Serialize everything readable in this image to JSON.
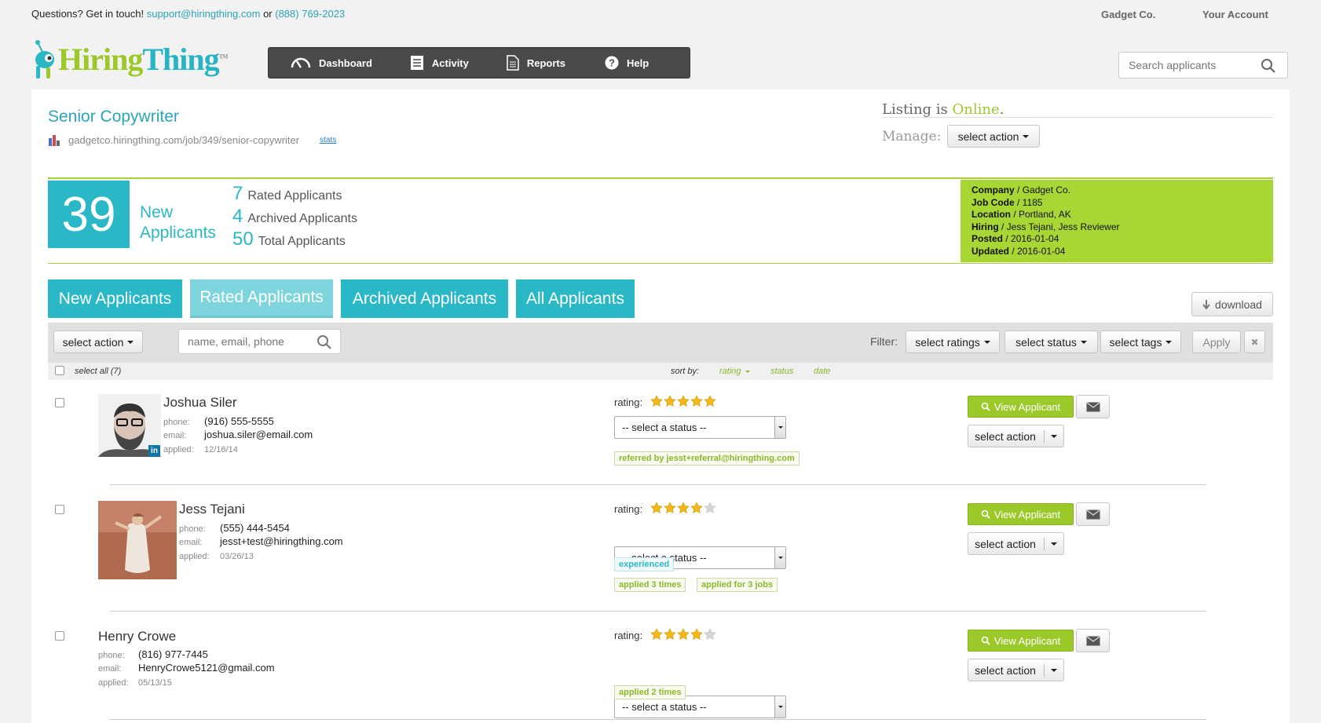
{
  "topbar": {
    "contact_prefix": "Questions? Get in touch!",
    "email": "support@hiringthing.com",
    "or": "or",
    "phone": "(888) 769-2023",
    "company": "Gadget Co.",
    "account": "Your Account"
  },
  "brand": {
    "part1": "H",
    "part2": "iring",
    "part3": "Thing",
    "tm": "TM",
    "colors": {
      "teal": "#2ab7c6",
      "green": "#9cc92a"
    }
  },
  "nav": {
    "items": [
      {
        "label": "Dashboard",
        "icon": "speedometer-icon"
      },
      {
        "label": "Activity",
        "icon": "list-icon"
      },
      {
        "label": "Reports",
        "icon": "document-icon"
      },
      {
        "label": "Help",
        "icon": "help-icon"
      }
    ]
  },
  "search": {
    "placeholder": "Search applicants"
  },
  "job": {
    "title": "Senior Copywriter",
    "url": "gadgetco.hiringthing.com/job/349/senior-copywriter",
    "stats_link": "stats",
    "listing_prefix": "Listing is",
    "listing_status": "Online",
    "listing_suffix": ".",
    "manage_label": "Manage:",
    "manage_action": "select action"
  },
  "summary": {
    "new_count": "39",
    "new_label_1": "New",
    "new_label_2": "Applicants",
    "rated_count": "7",
    "rated_label": "Rated Applicants",
    "archived_count": "4",
    "archived_label": "Archived Applicants",
    "total_count": "50",
    "total_label": "Total Applicants"
  },
  "meta": [
    {
      "key": "Company",
      "value": " / Gadget Co."
    },
    {
      "key": "Job Code",
      "value": " / 1185"
    },
    {
      "key": "Location",
      "value": " / Portland, AK"
    },
    {
      "key": "Hiring",
      "value": " / Jess Tejani, Jess Reviewer"
    },
    {
      "key": "Posted",
      "value": " / 2016-01-04"
    },
    {
      "key": "Updated",
      "value": " / 2016-01-04"
    }
  ],
  "tabs": [
    {
      "label": "New Applicants",
      "active": false
    },
    {
      "label": "Rated Applicants",
      "active": true
    },
    {
      "label": "Archived Applicants",
      "active": false
    },
    {
      "label": "All Applicants",
      "active": false
    }
  ],
  "download": "download",
  "filters": {
    "select_action": "select action",
    "name_placeholder": "name, email, phone",
    "filter_label": "Filter:",
    "ratings": "select ratings",
    "status": "select status",
    "tags": "select tags",
    "apply": "Apply",
    "clear": "✖"
  },
  "list": {
    "select_all": "select all (7)",
    "sort_by": "sort by:",
    "sort_rating": "rating",
    "sort_status": "status",
    "sort_date": "date"
  },
  "labels": {
    "phone": "phone:",
    "email": "email:",
    "applied": "applied:",
    "rating": "rating:",
    "status_placeholder": "-- select a status --",
    "view": "View Applicant",
    "action": "select action"
  },
  "applicants": [
    {
      "name": "Joshua Siler",
      "phone": "(916) 555-5555",
      "email": "joshua.siler@email.com",
      "applied": "12/16/14",
      "rating": 5,
      "tags": [
        "referred by jesst+referral@hiringthing.com"
      ],
      "linkedin": "in"
    },
    {
      "name": "Jess Tejani",
      "phone": "(555) 444-5454",
      "email": "jesst+test@hiringthing.com",
      "applied": "03/26/13",
      "rating": 4,
      "tags_blue": [
        "experienced"
      ],
      "tags": [
        "applied 3 times",
        "applied for 3 jobs"
      ]
    },
    {
      "name": "Henry Crowe",
      "phone": "(816) 977-7445",
      "email": "HenryCrowe5121@gmail.com",
      "applied": "05/13/15",
      "rating": 4,
      "tags": [
        "applied 2 times"
      ]
    }
  ]
}
